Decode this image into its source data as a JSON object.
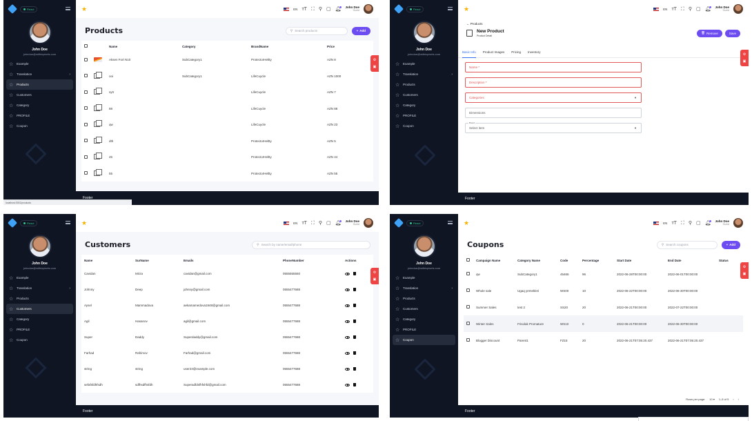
{
  "brand": {
    "name": "React",
    "accent": "#6d4df2",
    "sidebar_bg": "#0f1523",
    "footer_bg": "#0f1523"
  },
  "user": {
    "name": "John Doe",
    "email": "johndoe@withinpixels.com",
    "top_name": "John Doe",
    "top_sub": "Guest"
  },
  "topbar": {
    "lang": "EN"
  },
  "footer": "Footer",
  "sidebar_items": [
    {
      "label": "Example"
    },
    {
      "label": "Translation",
      "has_children": true
    },
    {
      "label": "Products"
    },
    {
      "label": "Customers"
    },
    {
      "label": "Category"
    },
    {
      "label": "PROFILE"
    },
    {
      "label": "Coupon"
    }
  ],
  "products": {
    "title": "Products",
    "search_placeholder": "Search products",
    "add_label": "Add",
    "columns": [
      "Name",
      "Category",
      "BrandName",
      "Price"
    ],
    "rows": [
      {
        "name": "Aksen Fort N10",
        "category": "SubCategory1",
        "brand": "ProtectorHeltty",
        "price": "AZN 8",
        "thumb": true
      },
      {
        "name": "ooi",
        "category": "SubCategory1",
        "brand": "LifeCuycle",
        "price": "AZN 1000"
      },
      {
        "name": "sytr",
        "category": "",
        "brand": "LifeCuycle",
        "price": "AZN 7"
      },
      {
        "name": "88",
        "category": "",
        "brand": "LifeCuycle",
        "price": "AZN 88"
      },
      {
        "name": "qw",
        "category": "",
        "brand": "LifeCuycle",
        "price": "AZN 23"
      },
      {
        "name": "dth",
        "category": "",
        "brand": "ProtectorHeltty",
        "price": "AZN 5"
      },
      {
        "name": "45",
        "category": "",
        "brand": "ProtectorHeltty",
        "price": "AZN 44"
      },
      {
        "name": "55",
        "category": "",
        "brand": "ProtectorHeltty",
        "price": "AZN 55"
      }
    ],
    "status_url": "localhost:3001/products"
  },
  "new_product": {
    "back_label": "Products",
    "title": "New Product",
    "subtitle": "Product Detail",
    "remove_label": "Remove",
    "save_label": "Save",
    "tabs": [
      "Basic Info",
      "Product Images",
      "Pricing",
      "Inventory"
    ],
    "fields": {
      "name": "Name *",
      "description": "Description *",
      "categories": "Categories",
      "dimensions": "Dimensions",
      "brand_label": "Brand",
      "brand_value": "Select item"
    }
  },
  "customers": {
    "title": "Customers",
    "search_placeholder": "Search by name/email/phone",
    "columns": [
      "Name",
      "SurName",
      "Emails",
      "PhoneNumber",
      "Actions"
    ],
    "rows": [
      {
        "name": "Cavidan",
        "surname": "Mirza",
        "email": "cavidan@gmail.com",
        "phone": "0555555550"
      },
      {
        "name": "Johnny",
        "surname": "Deep",
        "email": "johnny@gmail.com",
        "phone": "0555477688"
      },
      {
        "name": "Aysel",
        "surname": "Mammadova",
        "email": "aekamamedova1948@gmail.com",
        "phone": "0555477688"
      },
      {
        "name": "Agil",
        "surname": "Hasanov",
        "email": "agil@gmail.com",
        "phone": "0555477688"
      },
      {
        "name": "Super",
        "surname": "Daddy",
        "email": "Superdaddy@gmail.com",
        "phone": "0555477688"
      },
      {
        "name": "Farhad",
        "surname": "Rahimov",
        "email": "Farhad@gmail.com",
        "phone": "0555477688"
      },
      {
        "name": "string",
        "surname": "string",
        "email": "user23@example.com",
        "phone": "0555477688"
      },
      {
        "name": "sefafsfdhfsdh",
        "surname": "sdfhsdfhsfdh",
        "email": "Superadfdsfhfshfd@gmail.com",
        "phone": "0555477688"
      }
    ]
  },
  "coupons": {
    "title": "Coupons",
    "search_placeholder": "Search coupons",
    "add_label": "Add",
    "columns": [
      "Campaign Name",
      "Category Name",
      "Code",
      "Percentage",
      "Start Date",
      "End Date",
      "Status"
    ],
    "rows": [
      {
        "campaign": "qw",
        "category": "SubCategory1",
        "code": "45465",
        "pct": "96",
        "start": "2022-06-28T00:00:00",
        "end": "2022-06-01T00:00:00"
      },
      {
        "campaign": "Whole sale",
        "category": "Ugaq yemekleri",
        "code": "WS00",
        "pct": "10",
        "start": "2022-06-22T00:00:00",
        "end": "2022-06-30T00:00:00"
      },
      {
        "campaign": "Summer Sales",
        "category": "test 2",
        "code": "SS20",
        "pct": "20",
        "start": "2022-06-21T00:00:00",
        "end": "2022-07-22T00:00:00"
      },
      {
        "campaign": "Winter Sales",
        "category": "Frisolak Promature",
        "code": "WS10",
        "pct": "0",
        "start": "2022-06-21T00:00:00",
        "end": "2022-06-30T00:00:00"
      },
      {
        "campaign": "Blogger Discount",
        "category": "Parent1",
        "code": "FZ15",
        "pct": "20",
        "start": "2022-06-21T07:05:20.437",
        "end": "2022-06-21T07:05:20.437"
      }
    ],
    "pager": {
      "label": "Rows per page:",
      "per_page": "10",
      "range": "1–5 of 5"
    }
  }
}
